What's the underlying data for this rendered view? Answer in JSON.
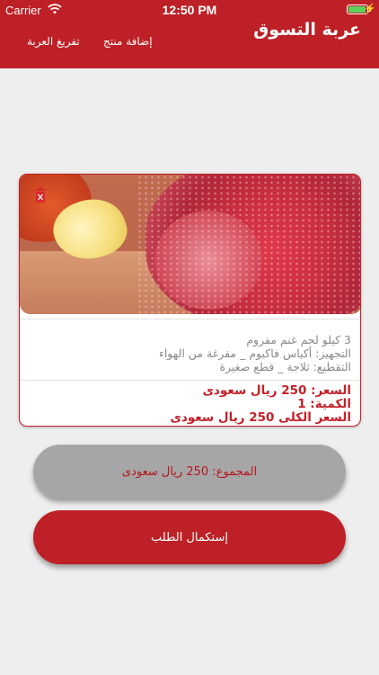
{
  "status_bar": {
    "carrier": "Carrier",
    "time": "12:50 PM",
    "wifi_icon": "wifi-icon",
    "battery_icon": "battery-icon",
    "charging_icon": "charging-bolt-icon"
  },
  "navbar": {
    "title": "عربة التسوق",
    "add_product": "إضافة منتج",
    "empty_cart": "تفريغ العربة"
  },
  "cart_item": {
    "image_alt": "minced-meat-photo",
    "delete_icon": "trash-icon",
    "name": "3 كيلو لحم غنم مفروم",
    "preparation": "التجهيز: أكياس فاكيوم _ مفرغة من الهواء",
    "cutting": "التقطيع: ثلاجة _ قطع صغيرة",
    "price": "السعر: 250 ريال سعودى",
    "quantity": "الكمية: 1",
    "line_total": "السعر الكلى 250 ريال سعودى"
  },
  "summary": {
    "total": "المجموع: 250 ريال سعودى"
  },
  "checkout": {
    "label": "إستكمال الطلب"
  },
  "colors": {
    "brand": "#bd2026",
    "total_button": "#a6a6a6",
    "background": "#eeeeee"
  }
}
